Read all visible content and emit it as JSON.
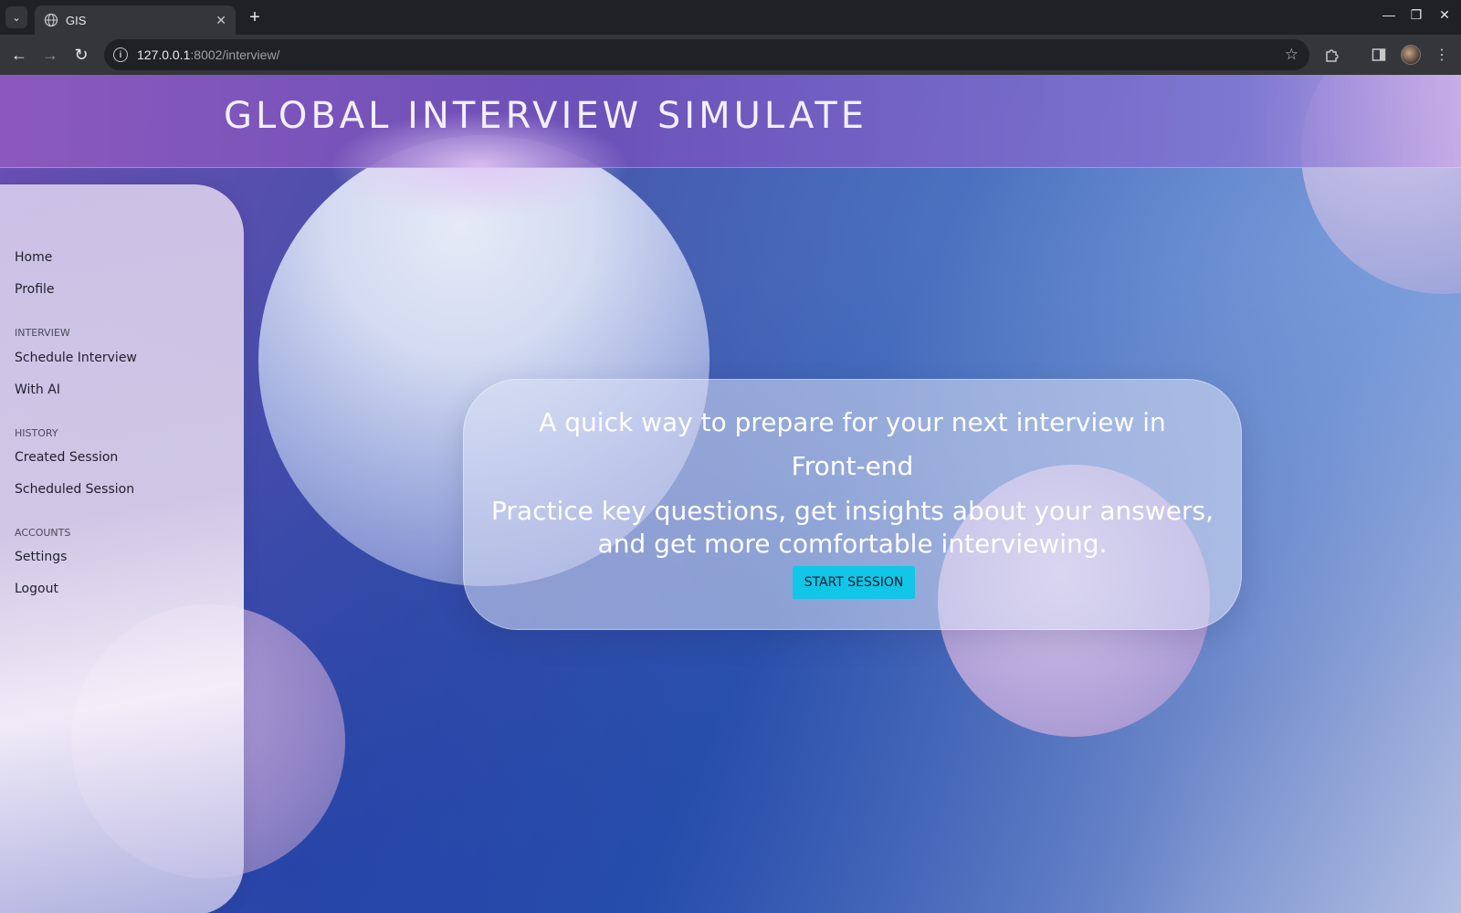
{
  "browser": {
    "tab_title": "GIS",
    "url_host": "127.0.0.1",
    "url_path": ":8002/interview/",
    "new_tab_symbol": "+",
    "close_symbol": "✕"
  },
  "header": {
    "title": "GLOBAL INTERVIEW SIMULATE"
  },
  "sidebar": {
    "items": [
      {
        "label": "Home"
      },
      {
        "label": "Profile"
      }
    ],
    "sections": [
      {
        "heading": "INTERVIEW",
        "items": [
          {
            "label": "Schedule Interview"
          },
          {
            "label": "With AI"
          }
        ]
      },
      {
        "heading": "HISTORY",
        "items": [
          {
            "label": "Created Session"
          },
          {
            "label": "Scheduled Session"
          }
        ]
      },
      {
        "heading": "ACCOUNTS",
        "items": [
          {
            "label": "Settings"
          },
          {
            "label": "Logout"
          }
        ]
      }
    ]
  },
  "hero": {
    "line1": "A quick way to prepare for your next interview in",
    "line2": "Front-end",
    "line3": "Practice key questions, get insights about your answers, and get more comfortable interviewing.",
    "button_label": "START SESSION"
  },
  "colors": {
    "accent_button": "#12c6e8",
    "header_purple": "#6e50b9",
    "background_blue": "#2f55ac"
  }
}
